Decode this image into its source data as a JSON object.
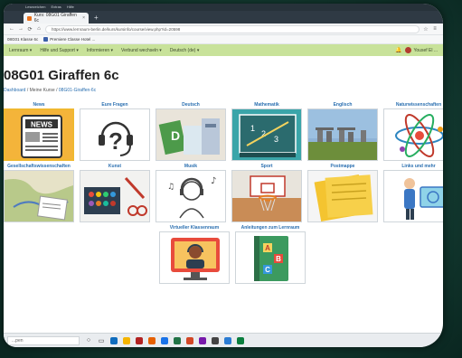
{
  "browser": {
    "menu": [
      "Lesezeichen",
      "Extras",
      "Hilfe"
    ],
    "tab_title": "Kurs: 08G01 Giraffen 6c",
    "tab_close": "×",
    "new_tab": "+",
    "url": "https://www.lernraum-berlin.de/kurs/kursinfo/course/view.php?id=20598",
    "bookmarks": [
      "08G01 Klasse 6c",
      "Premiere Classe Hotel ..."
    ]
  },
  "site_nav": {
    "items": [
      "Lernraum ▾",
      "Hilfe und Support ▾",
      "Informieren ▾",
      "Verbund wechseln ▾",
      "Deutsch (de) ▾"
    ],
    "user": "Yousef El ..."
  },
  "page": {
    "title": "08G01 Giraffen 6c",
    "breadcrumb": [
      "Dashboard",
      "Meine Kurse",
      "08G01-Giraffen-6c"
    ],
    "breadcrumb_sep": "/"
  },
  "tiles": [
    {
      "label": "News",
      "icon": "newspaper-icon",
      "active": true
    },
    {
      "label": "Eure Fragen",
      "icon": "question-headset-icon"
    },
    {
      "label": "Deutsch",
      "icon": "books-icon"
    },
    {
      "label": "Mathematik",
      "icon": "chalkboard-math-icon"
    },
    {
      "label": "Englisch",
      "icon": "stonehenge-icon"
    },
    {
      "label": "Naturwissenschaften",
      "icon": "atom-icon"
    },
    {
      "label": "Gesellschaftswissenschaften",
      "icon": "map-icon"
    },
    {
      "label": "Kunst",
      "icon": "paint-box-icon"
    },
    {
      "label": "Musik",
      "icon": "musician-sketch-icon"
    },
    {
      "label": "Sport",
      "icon": "basketball-hoop-icon"
    },
    {
      "label": "Postmappe",
      "icon": "folder-icon"
    },
    {
      "label": "Links und mehr",
      "icon": "web-person-icon"
    },
    {
      "label": "Virtueller Klassenraum",
      "icon": "video-call-icon"
    },
    {
      "label": "Anleitungen zum Lernraum",
      "icon": "book-abc-icon"
    }
  ],
  "taskbar": {
    "search_text": "...pen"
  },
  "colors": {
    "nav_bg": "#c8e29a",
    "link": "#2a6fb0",
    "active_border": "#f0b830"
  }
}
